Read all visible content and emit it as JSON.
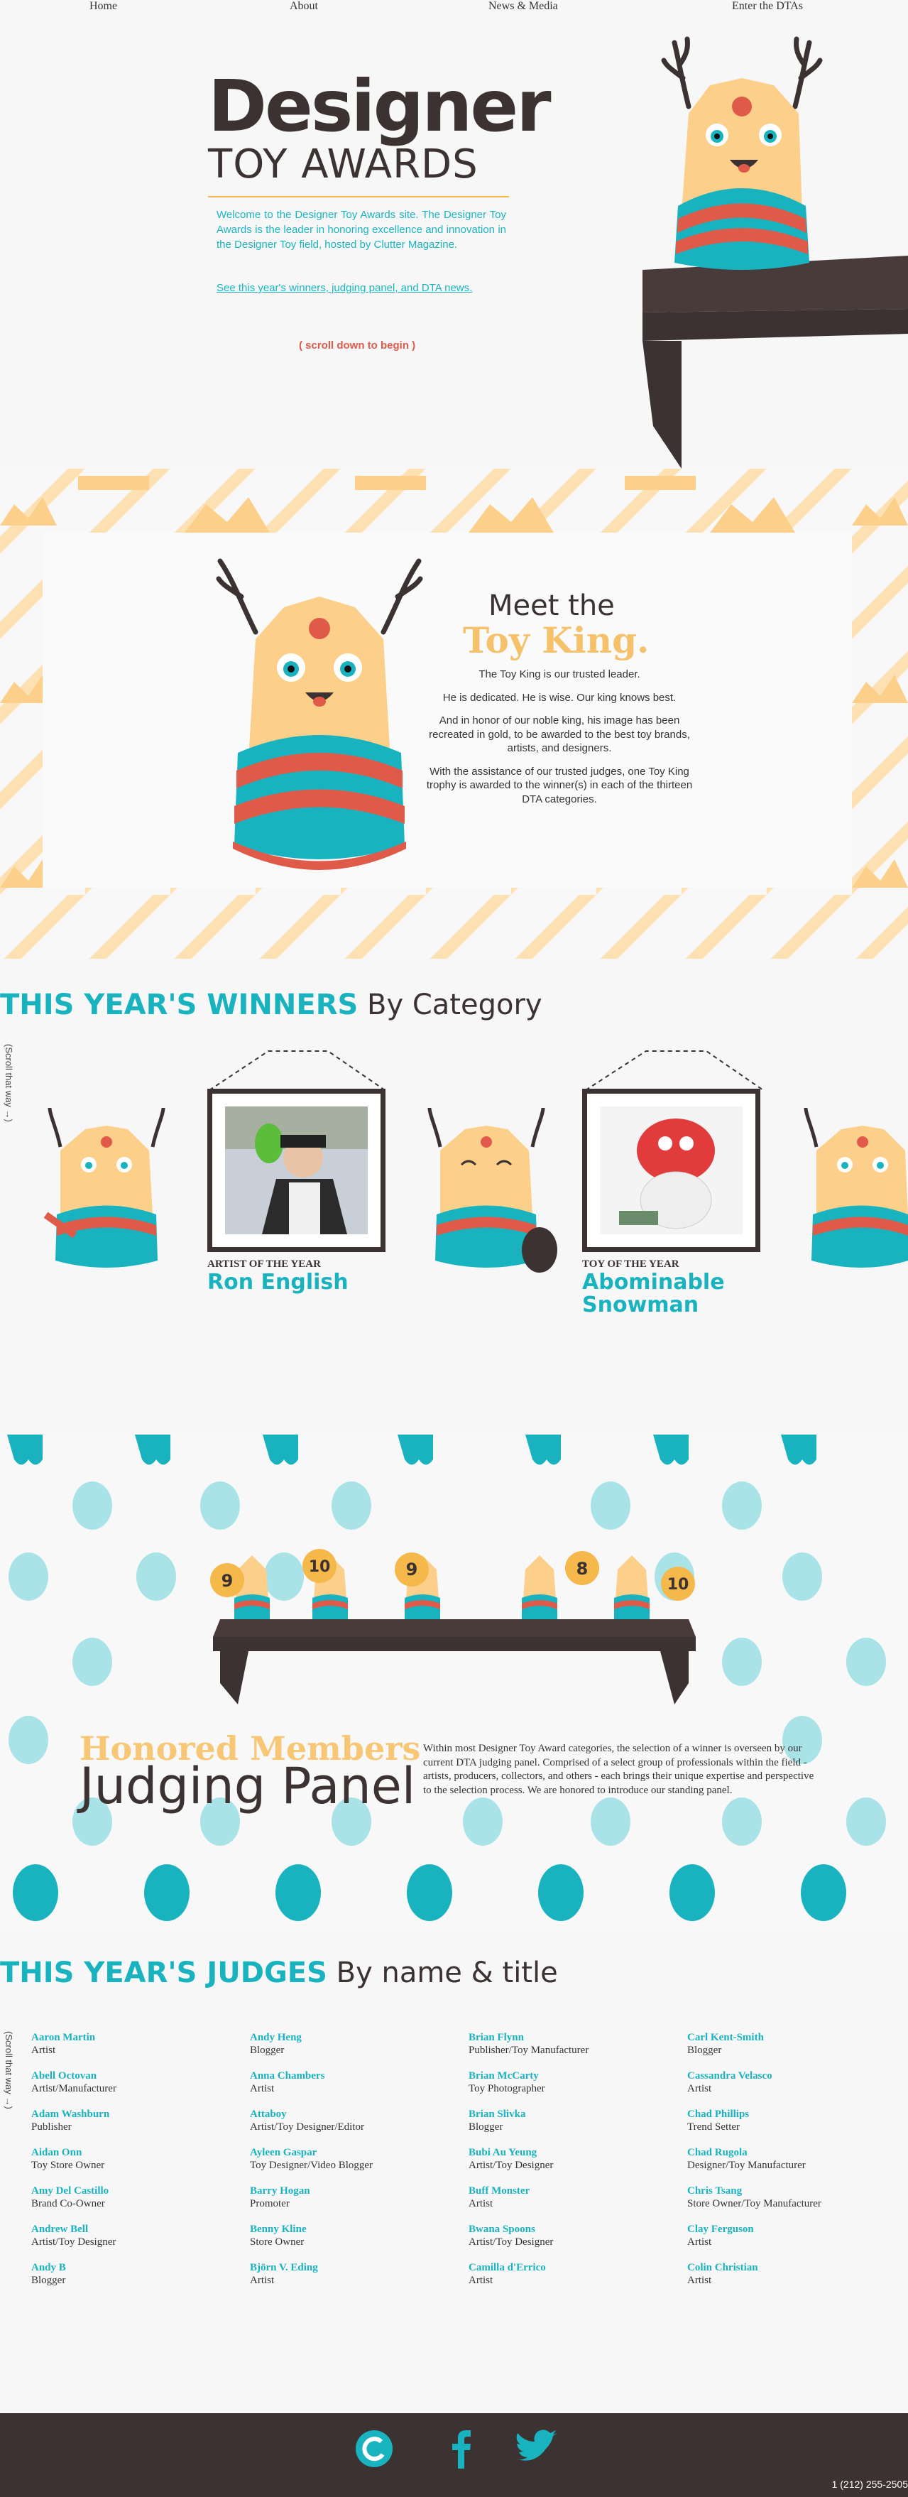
{
  "nav": {
    "home": "Home",
    "about": "About",
    "news": "News & Media",
    "enter": "Enter the DTAs"
  },
  "hero": {
    "title": "Designer",
    "subtitle": "TOY AWARDS",
    "description": "Welcome to the Designer Toy Awards site. The Designer Toy Awards is the leader in honoring excellence and innovation in the Designer Toy field, hosted by Clutter Magazine.",
    "link": "See this year's winners, judging panel, and DTA news.",
    "scroll": "( scroll down to begin )"
  },
  "king": {
    "heading1": "Meet the",
    "heading2": "Toy King.",
    "p1": "The Toy King is our trusted leader.",
    "p2": "He is dedicated. He is wise. Our king knows best.",
    "p3": "And in honor of our noble king, his image has been recreated in gold, to be awarded to the best toy brands, artists, and designers.",
    "p4": "With the assistance of our trusted judges, one Toy King trophy is awarded to the winner(s) in each of the thirteen DTA categories."
  },
  "winners": {
    "head_bold": "THIS YEAR'S WINNERS",
    "head_rest": " By Category",
    "scroll_note": "(Scroll that way →)",
    "items": [
      {
        "category": "ARTIST OF THE YEAR",
        "name": "Ron English"
      },
      {
        "category": "TOY OF THE YEAR",
        "name": "Abominable Snowman"
      }
    ],
    "trophy_numbers": [
      "9",
      "10",
      "9",
      "8",
      "10"
    ]
  },
  "panel": {
    "h1": "Honored Members",
    "h2": "Judging Panel",
    "text": "Within most Designer Toy Award categories, the selection of a winner is overseen by our current DTA judging panel. Comprised of a select group of professionals within the field - artists, producers, collectors, and others - each brings their unique expertise and perspective to the selection process. We are honored to introduce our standing panel."
  },
  "judges": {
    "head_bold": "THIS YEAR'S JUDGES",
    "head_rest": " By name & title",
    "scroll_note": "(Scroll that way →)",
    "columns": [
      [
        {
          "name": "Aaron Martin",
          "title": "Artist"
        },
        {
          "name": "Abell Octovan",
          "title": "Artist/Manufacturer"
        },
        {
          "name": "Adam Washburn",
          "title": "Publisher"
        },
        {
          "name": "Aidan Onn",
          "title": "Toy Store Owner"
        },
        {
          "name": "Amy Del Castillo",
          "title": "Brand Co-Owner"
        },
        {
          "name": "Andrew Bell",
          "title": "Artist/Toy Designer"
        },
        {
          "name": "Andy B",
          "title": "Blogger"
        }
      ],
      [
        {
          "name": "Andy Heng",
          "title": "Blogger"
        },
        {
          "name": "Anna Chambers",
          "title": "Artist"
        },
        {
          "name": "Attaboy",
          "title": "Artist/Toy Designer/Editor"
        },
        {
          "name": "Ayleen Gaspar",
          "title": "Toy Designer/Video Blogger"
        },
        {
          "name": "Barry Hogan",
          "title": "Promoter"
        },
        {
          "name": "Benny Kline",
          "title": "Store Owner"
        },
        {
          "name": "Björn V. Eding",
          "title": "Artist"
        }
      ],
      [
        {
          "name": "Brian Flynn",
          "title": "Publisher/Toy Manufacturer"
        },
        {
          "name": "Brian McCarty",
          "title": "Toy Photographer"
        },
        {
          "name": "Brian Slivka",
          "title": "Blogger"
        },
        {
          "name": "Bubi Au Yeung",
          "title": "Artist/Toy Designer"
        },
        {
          "name": "Buff Monster",
          "title": "Artist"
        },
        {
          "name": "Bwana Spoons",
          "title": "Artist/Toy Designer"
        },
        {
          "name": "Camilla d'Errico",
          "title": "Artist"
        }
      ],
      [
        {
          "name": "Carl Kent-Smith",
          "title": "Blogger"
        },
        {
          "name": "Cassandra Velasco",
          "title": "Artist"
        },
        {
          "name": "Chad Phillips",
          "title": "Trend Setter"
        },
        {
          "name": "Chad Rugola",
          "title": "Designer/Toy Manufacturer"
        },
        {
          "name": "Chris Tsang",
          "title": "Store Owner/Toy Manufacturer"
        },
        {
          "name": "Clay Ferguson",
          "title": "Artist"
        },
        {
          "name": "Colin Christian",
          "title": "Artist"
        }
      ]
    ]
  },
  "footer": {
    "phone": "1 (212) 255-2505",
    "icons": [
      "clutter-icon",
      "facebook-icon",
      "twitter-icon"
    ]
  },
  "colors": {
    "teal": "#19b3bf",
    "dark": "#3c3232",
    "gold": "#f5c26b",
    "red": "#e05a4a"
  }
}
